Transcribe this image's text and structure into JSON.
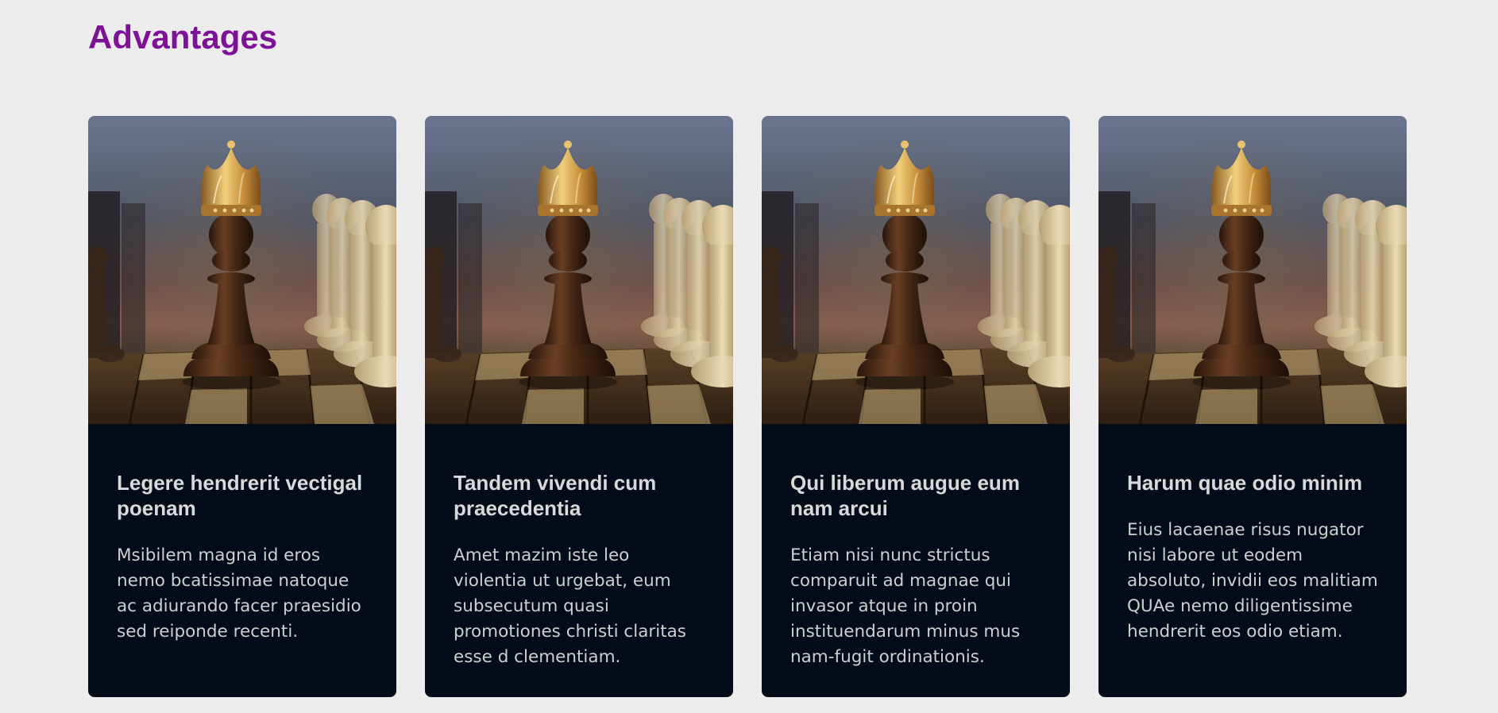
{
  "section": {
    "title": "Advantages",
    "title_color": "#7d1297"
  },
  "colors": {
    "background": "#ececec",
    "card_body": "#030c18",
    "card_title": "#d9d9d9",
    "card_text": "#cfcfcf"
  },
  "cards": [
    {
      "title": "Legere hendrerit vectigal poenam",
      "text": "Msibilem magna id eros nemo bcatissimae natoque ac adiurando facer praesidio sed reiponde recenti.",
      "image": "chess-king-pawn-photo"
    },
    {
      "title": "Tandem vivendi cum praecedentia",
      "text": "Amet mazim iste leo violentia ut urgebat, eum subsecutum quasi promotiones christi claritas esse d clementiam.",
      "image": "chess-king-pawn-photo"
    },
    {
      "title": "Qui liberum augue eum nam arcui",
      "text": "Etiam nisi nunc strictus comparuit ad magnae qui invasor atque in proin instituendarum minus mus nam-fugit ordinationis.",
      "image": "chess-king-pawn-photo"
    },
    {
      "title": "Harum quae odio minim",
      "text": "Eius lacaenae risus nugator nisi labore ut eodem absoluto, invidii eos malitiam QUAe nemo diligentissime hendrerit eos odio etiam.",
      "image": "chess-king-pawn-photo"
    }
  ]
}
